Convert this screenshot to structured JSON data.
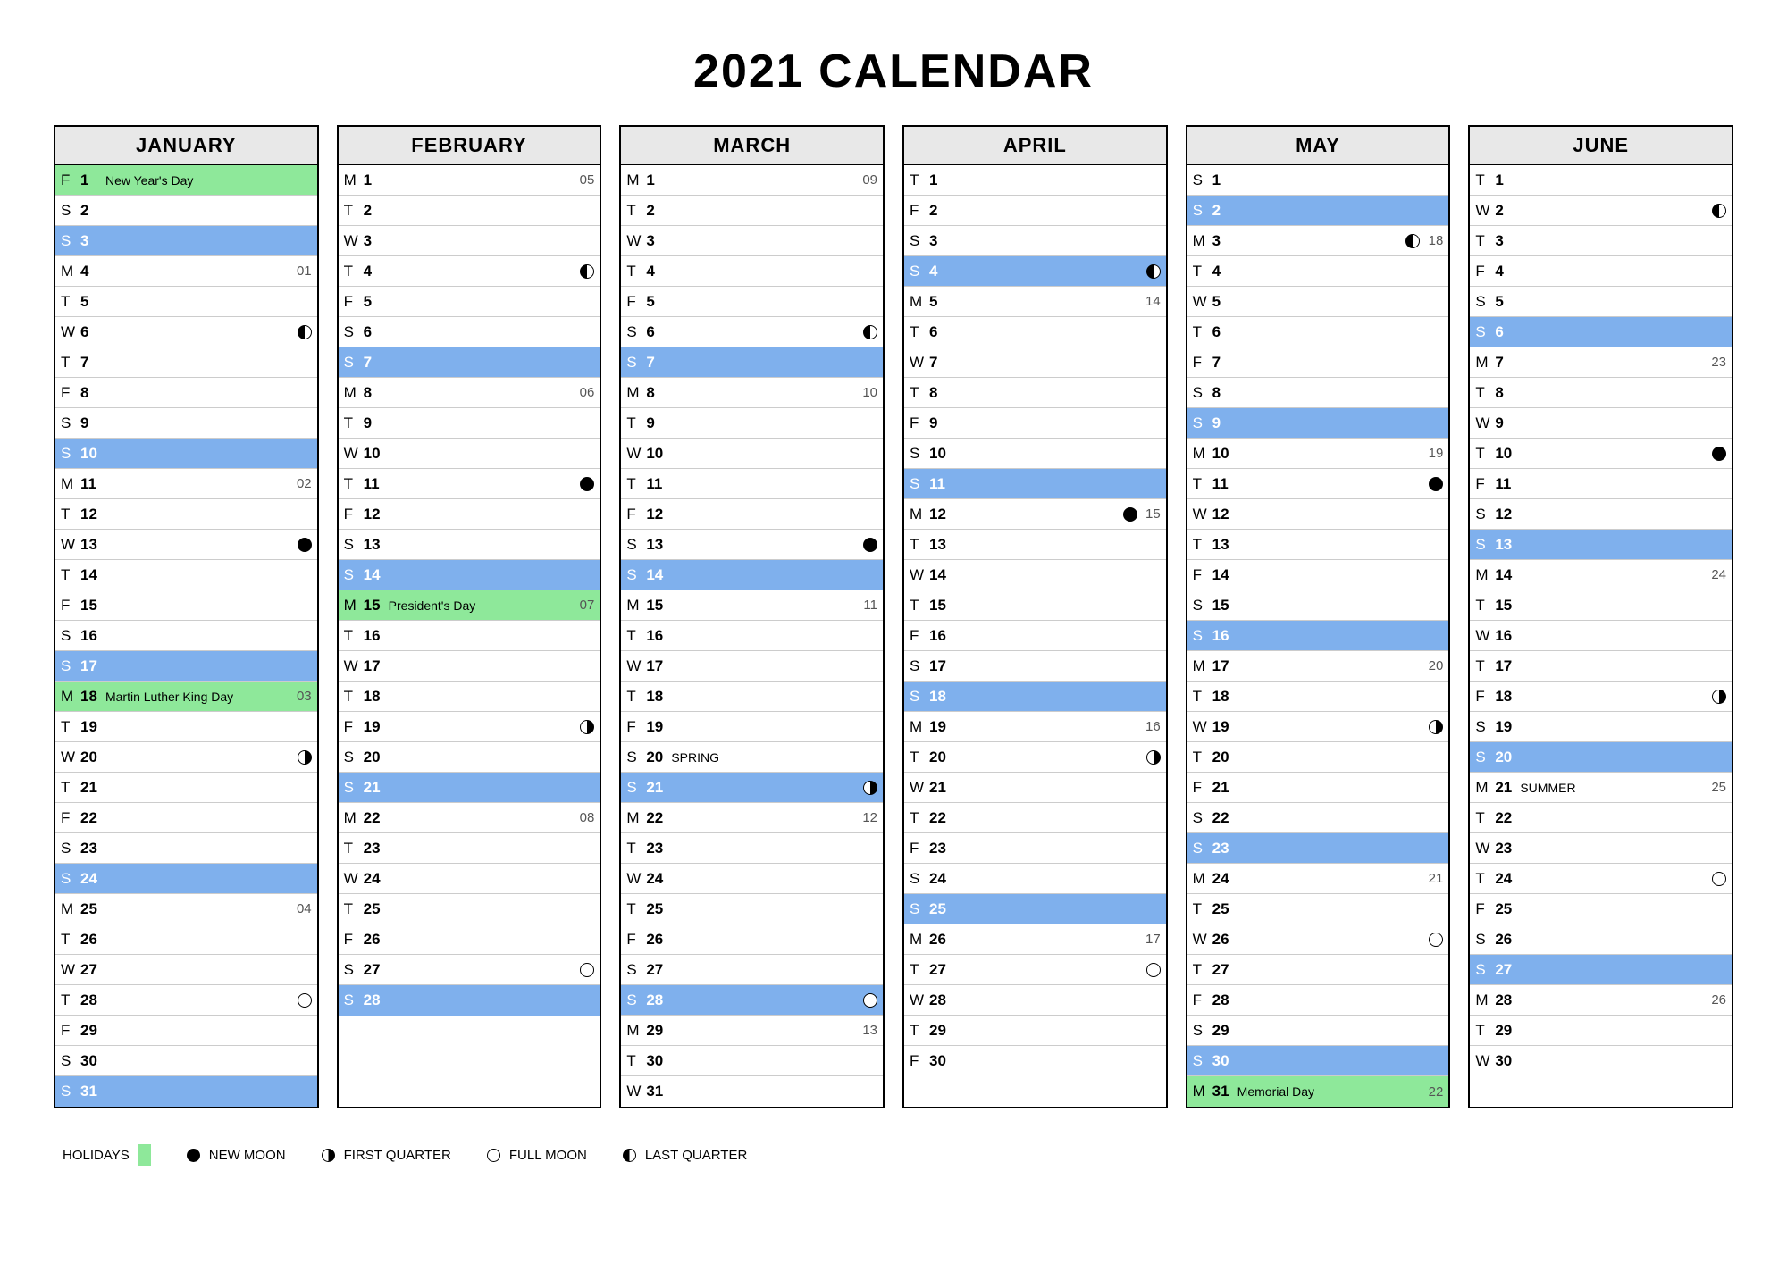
{
  "title": "2021 CALENDAR",
  "legend": {
    "holidays": "HOLIDAYS",
    "new_moon": "NEW MOON",
    "first_quarter": "FIRST QUARTER",
    "full_moon": "FULL MOON",
    "last_quarter": "LAST QUARTER"
  },
  "months": [
    {
      "name": "JANUARY",
      "days": [
        {
          "dow": "F",
          "n": "1",
          "label": "New Year's Day",
          "holiday": true
        },
        {
          "dow": "S",
          "n": "2"
        },
        {
          "dow": "S",
          "n": "3",
          "sunday": true
        },
        {
          "dow": "M",
          "n": "4",
          "wk": "01"
        },
        {
          "dow": "T",
          "n": "5"
        },
        {
          "dow": "W",
          "n": "6",
          "moon": "last"
        },
        {
          "dow": "T",
          "n": "7"
        },
        {
          "dow": "F",
          "n": "8"
        },
        {
          "dow": "S",
          "n": "9"
        },
        {
          "dow": "S",
          "n": "10",
          "sunday": true
        },
        {
          "dow": "M",
          "n": "11",
          "wk": "02"
        },
        {
          "dow": "T",
          "n": "12"
        },
        {
          "dow": "W",
          "n": "13",
          "moon": "new"
        },
        {
          "dow": "T",
          "n": "14"
        },
        {
          "dow": "F",
          "n": "15"
        },
        {
          "dow": "S",
          "n": "16"
        },
        {
          "dow": "S",
          "n": "17",
          "sunday": true
        },
        {
          "dow": "M",
          "n": "18",
          "label": "Martin Luther King Day",
          "holiday": true,
          "wk": "03"
        },
        {
          "dow": "T",
          "n": "19"
        },
        {
          "dow": "W",
          "n": "20",
          "moon": "first"
        },
        {
          "dow": "T",
          "n": "21"
        },
        {
          "dow": "F",
          "n": "22"
        },
        {
          "dow": "S",
          "n": "23"
        },
        {
          "dow": "S",
          "n": "24",
          "sunday": true
        },
        {
          "dow": "M",
          "n": "25",
          "wk": "04"
        },
        {
          "dow": "T",
          "n": "26"
        },
        {
          "dow": "W",
          "n": "27"
        },
        {
          "dow": "T",
          "n": "28",
          "moon": "full"
        },
        {
          "dow": "F",
          "n": "29"
        },
        {
          "dow": "S",
          "n": "30"
        },
        {
          "dow": "S",
          "n": "31",
          "sunday": true
        }
      ]
    },
    {
      "name": "FEBRUARY",
      "days": [
        {
          "dow": "M",
          "n": "1",
          "wk": "05"
        },
        {
          "dow": "T",
          "n": "2"
        },
        {
          "dow": "W",
          "n": "3"
        },
        {
          "dow": "T",
          "n": "4",
          "moon": "last"
        },
        {
          "dow": "F",
          "n": "5"
        },
        {
          "dow": "S",
          "n": "6"
        },
        {
          "dow": "S",
          "n": "7",
          "sunday": true
        },
        {
          "dow": "M",
          "n": "8",
          "wk": "06"
        },
        {
          "dow": "T",
          "n": "9"
        },
        {
          "dow": "W",
          "n": "10"
        },
        {
          "dow": "T",
          "n": "11",
          "moon": "new"
        },
        {
          "dow": "F",
          "n": "12"
        },
        {
          "dow": "S",
          "n": "13"
        },
        {
          "dow": "S",
          "n": "14",
          "sunday": true
        },
        {
          "dow": "M",
          "n": "15",
          "label": "President's Day",
          "holiday": true,
          "wk": "07"
        },
        {
          "dow": "T",
          "n": "16"
        },
        {
          "dow": "W",
          "n": "17"
        },
        {
          "dow": "T",
          "n": "18"
        },
        {
          "dow": "F",
          "n": "19",
          "moon": "first"
        },
        {
          "dow": "S",
          "n": "20"
        },
        {
          "dow": "S",
          "n": "21",
          "sunday": true
        },
        {
          "dow": "M",
          "n": "22",
          "wk": "08"
        },
        {
          "dow": "T",
          "n": "23"
        },
        {
          "dow": "W",
          "n": "24"
        },
        {
          "dow": "T",
          "n": "25"
        },
        {
          "dow": "F",
          "n": "26"
        },
        {
          "dow": "S",
          "n": "27",
          "moon": "full"
        },
        {
          "dow": "S",
          "n": "28",
          "sunday": true
        }
      ]
    },
    {
      "name": "MARCH",
      "days": [
        {
          "dow": "M",
          "n": "1",
          "wk": "09"
        },
        {
          "dow": "T",
          "n": "2"
        },
        {
          "dow": "W",
          "n": "3"
        },
        {
          "dow": "T",
          "n": "4"
        },
        {
          "dow": "F",
          "n": "5"
        },
        {
          "dow": "S",
          "n": "6",
          "moon": "last"
        },
        {
          "dow": "S",
          "n": "7",
          "sunday": true
        },
        {
          "dow": "M",
          "n": "8",
          "wk": "10"
        },
        {
          "dow": "T",
          "n": "9"
        },
        {
          "dow": "W",
          "n": "10"
        },
        {
          "dow": "T",
          "n": "11"
        },
        {
          "dow": "F",
          "n": "12"
        },
        {
          "dow": "S",
          "n": "13",
          "moon": "new"
        },
        {
          "dow": "S",
          "n": "14",
          "sunday": true
        },
        {
          "dow": "M",
          "n": "15",
          "wk": "11"
        },
        {
          "dow": "T",
          "n": "16"
        },
        {
          "dow": "W",
          "n": "17"
        },
        {
          "dow": "T",
          "n": "18"
        },
        {
          "dow": "F",
          "n": "19"
        },
        {
          "dow": "S",
          "n": "20",
          "label": "SPRING"
        },
        {
          "dow": "S",
          "n": "21",
          "sunday": true,
          "moon": "first"
        },
        {
          "dow": "M",
          "n": "22",
          "wk": "12"
        },
        {
          "dow": "T",
          "n": "23"
        },
        {
          "dow": "W",
          "n": "24"
        },
        {
          "dow": "T",
          "n": "25"
        },
        {
          "dow": "F",
          "n": "26"
        },
        {
          "dow": "S",
          "n": "27"
        },
        {
          "dow": "S",
          "n": "28",
          "sunday": true,
          "moon": "full"
        },
        {
          "dow": "M",
          "n": "29",
          "wk": "13"
        },
        {
          "dow": "T",
          "n": "30"
        },
        {
          "dow": "W",
          "n": "31"
        }
      ]
    },
    {
      "name": "APRIL",
      "days": [
        {
          "dow": "T",
          "n": "1"
        },
        {
          "dow": "F",
          "n": "2"
        },
        {
          "dow": "S",
          "n": "3"
        },
        {
          "dow": "S",
          "n": "4",
          "sunday": true,
          "moon": "last"
        },
        {
          "dow": "M",
          "n": "5",
          "wk": "14"
        },
        {
          "dow": "T",
          "n": "6"
        },
        {
          "dow": "W",
          "n": "7"
        },
        {
          "dow": "T",
          "n": "8"
        },
        {
          "dow": "F",
          "n": "9"
        },
        {
          "dow": "S",
          "n": "10"
        },
        {
          "dow": "S",
          "n": "11",
          "sunday": true
        },
        {
          "dow": "M",
          "n": "12",
          "moon": "new",
          "wk": "15"
        },
        {
          "dow": "T",
          "n": "13"
        },
        {
          "dow": "W",
          "n": "14"
        },
        {
          "dow": "T",
          "n": "15"
        },
        {
          "dow": "F",
          "n": "16"
        },
        {
          "dow": "S",
          "n": "17"
        },
        {
          "dow": "S",
          "n": "18",
          "sunday": true
        },
        {
          "dow": "M",
          "n": "19",
          "wk": "16"
        },
        {
          "dow": "T",
          "n": "20",
          "moon": "first"
        },
        {
          "dow": "W",
          "n": "21"
        },
        {
          "dow": "T",
          "n": "22"
        },
        {
          "dow": "F",
          "n": "23"
        },
        {
          "dow": "S",
          "n": "24"
        },
        {
          "dow": "S",
          "n": "25",
          "sunday": true
        },
        {
          "dow": "M",
          "n": "26",
          "wk": "17"
        },
        {
          "dow": "T",
          "n": "27",
          "moon": "full"
        },
        {
          "dow": "W",
          "n": "28"
        },
        {
          "dow": "T",
          "n": "29"
        },
        {
          "dow": "F",
          "n": "30"
        }
      ]
    },
    {
      "name": "MAY",
      "days": [
        {
          "dow": "S",
          "n": "1"
        },
        {
          "dow": "S",
          "n": "2",
          "sunday": true
        },
        {
          "dow": "M",
          "n": "3",
          "moon": "last",
          "wk": "18"
        },
        {
          "dow": "T",
          "n": "4"
        },
        {
          "dow": "W",
          "n": "5"
        },
        {
          "dow": "T",
          "n": "6"
        },
        {
          "dow": "F",
          "n": "7"
        },
        {
          "dow": "S",
          "n": "8"
        },
        {
          "dow": "S",
          "n": "9",
          "sunday": true
        },
        {
          "dow": "M",
          "n": "10",
          "wk": "19"
        },
        {
          "dow": "T",
          "n": "11",
          "moon": "new"
        },
        {
          "dow": "W",
          "n": "12"
        },
        {
          "dow": "T",
          "n": "13"
        },
        {
          "dow": "F",
          "n": "14"
        },
        {
          "dow": "S",
          "n": "15"
        },
        {
          "dow": "S",
          "n": "16",
          "sunday": true
        },
        {
          "dow": "M",
          "n": "17",
          "wk": "20"
        },
        {
          "dow": "T",
          "n": "18"
        },
        {
          "dow": "W",
          "n": "19",
          "moon": "first"
        },
        {
          "dow": "T",
          "n": "20"
        },
        {
          "dow": "F",
          "n": "21"
        },
        {
          "dow": "S",
          "n": "22"
        },
        {
          "dow": "S",
          "n": "23",
          "sunday": true
        },
        {
          "dow": "M",
          "n": "24",
          "wk": "21"
        },
        {
          "dow": "T",
          "n": "25"
        },
        {
          "dow": "W",
          "n": "26",
          "moon": "full"
        },
        {
          "dow": "T",
          "n": "27"
        },
        {
          "dow": "F",
          "n": "28"
        },
        {
          "dow": "S",
          "n": "29"
        },
        {
          "dow": "S",
          "n": "30",
          "sunday": true
        },
        {
          "dow": "M",
          "n": "31",
          "label": "Memorial Day",
          "holiday": true,
          "wk": "22"
        }
      ]
    },
    {
      "name": "JUNE",
      "days": [
        {
          "dow": "T",
          "n": "1"
        },
        {
          "dow": "W",
          "n": "2",
          "moon": "last"
        },
        {
          "dow": "T",
          "n": "3"
        },
        {
          "dow": "F",
          "n": "4"
        },
        {
          "dow": "S",
          "n": "5"
        },
        {
          "dow": "S",
          "n": "6",
          "sunday": true
        },
        {
          "dow": "M",
          "n": "7",
          "wk": "23"
        },
        {
          "dow": "T",
          "n": "8"
        },
        {
          "dow": "W",
          "n": "9"
        },
        {
          "dow": "T",
          "n": "10",
          "moon": "new"
        },
        {
          "dow": "F",
          "n": "11"
        },
        {
          "dow": "S",
          "n": "12"
        },
        {
          "dow": "S",
          "n": "13",
          "sunday": true
        },
        {
          "dow": "M",
          "n": "14",
          "wk": "24"
        },
        {
          "dow": "T",
          "n": "15"
        },
        {
          "dow": "W",
          "n": "16"
        },
        {
          "dow": "T",
          "n": "17"
        },
        {
          "dow": "F",
          "n": "18",
          "moon": "first"
        },
        {
          "dow": "S",
          "n": "19"
        },
        {
          "dow": "S",
          "n": "20",
          "sunday": true
        },
        {
          "dow": "M",
          "n": "21",
          "label": "SUMMER",
          "wk": "25"
        },
        {
          "dow": "T",
          "n": "22"
        },
        {
          "dow": "W",
          "n": "23"
        },
        {
          "dow": "T",
          "n": "24",
          "moon": "full"
        },
        {
          "dow": "F",
          "n": "25"
        },
        {
          "dow": "S",
          "n": "26"
        },
        {
          "dow": "S",
          "n": "27",
          "sunday": true
        },
        {
          "dow": "M",
          "n": "28",
          "wk": "26"
        },
        {
          "dow": "T",
          "n": "29"
        },
        {
          "dow": "W",
          "n": "30"
        }
      ]
    }
  ]
}
